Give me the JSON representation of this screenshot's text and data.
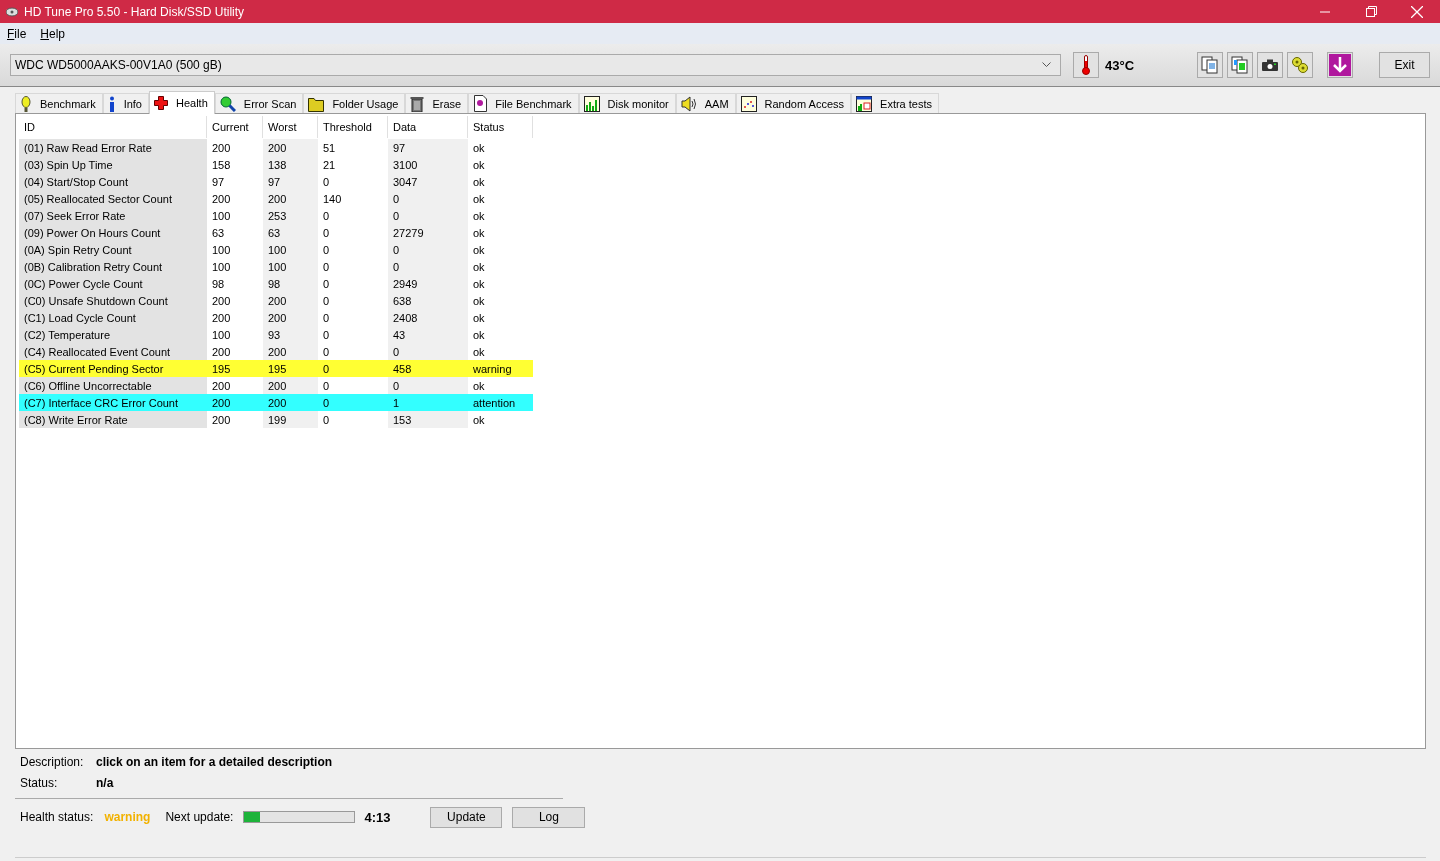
{
  "window": {
    "title": "HD Tune Pro 5.50 - Hard Disk/SSD Utility"
  },
  "menu": [
    {
      "label": "File",
      "accel_underlined": true
    },
    {
      "label": "Help",
      "accel_underlined": true
    }
  ],
  "toolbar": {
    "drive": "WDC WD5000AAKS-00V1A0 (500 gB)",
    "temperature": "43°C",
    "exit": "Exit"
  },
  "tabs": [
    {
      "label": "Benchmark",
      "selected": false
    },
    {
      "label": "Info",
      "selected": false
    },
    {
      "label": "Health",
      "selected": true
    },
    {
      "label": "Error Scan",
      "selected": false
    },
    {
      "label": "Folder Usage",
      "selected": false
    },
    {
      "label": "Erase",
      "selected": false
    },
    {
      "label": "File Benchmark",
      "selected": false
    },
    {
      "label": "Disk monitor",
      "selected": false
    },
    {
      "label": "AAM",
      "selected": false
    },
    {
      "label": "Random Access",
      "selected": false
    },
    {
      "label": "Extra tests",
      "selected": false
    }
  ],
  "table": {
    "columns": [
      "ID",
      "Current",
      "Worst",
      "Threshold",
      "Data",
      "Status"
    ],
    "rows": [
      {
        "cells": [
          "(01) Raw Read Error Rate",
          "200",
          "200",
          "51",
          "97",
          "ok"
        ]
      },
      {
        "cells": [
          "(03) Spin Up Time",
          "158",
          "138",
          "21",
          "3100",
          "ok"
        ]
      },
      {
        "cells": [
          "(04) Start/Stop Count",
          "97",
          "97",
          "0",
          "3047",
          "ok"
        ]
      },
      {
        "cells": [
          "(05) Reallocated Sector Count",
          "200",
          "200",
          "140",
          "0",
          "ok"
        ]
      },
      {
        "cells": [
          "(07) Seek Error Rate",
          "100",
          "253",
          "0",
          "0",
          "ok"
        ]
      },
      {
        "cells": [
          "(09) Power On Hours Count",
          "63",
          "63",
          "0",
          "27279",
          "ok"
        ]
      },
      {
        "cells": [
          "(0A) Spin Retry Count",
          "100",
          "100",
          "0",
          "0",
          "ok"
        ]
      },
      {
        "cells": [
          "(0B) Calibration Retry Count",
          "100",
          "100",
          "0",
          "0",
          "ok"
        ]
      },
      {
        "cells": [
          "(0C) Power Cycle Count",
          "98",
          "98",
          "0",
          "2949",
          "ok"
        ]
      },
      {
        "cells": [
          "(C0) Unsafe Shutdown Count",
          "200",
          "200",
          "0",
          "638",
          "ok"
        ]
      },
      {
        "cells": [
          "(C1) Load Cycle Count",
          "200",
          "200",
          "0",
          "2408",
          "ok"
        ]
      },
      {
        "cells": [
          "(C2) Temperature",
          "100",
          "93",
          "0",
          "43",
          "ok"
        ]
      },
      {
        "cells": [
          "(C4) Reallocated Event Count",
          "200",
          "200",
          "0",
          "0",
          "ok"
        ]
      },
      {
        "cells": [
          "(C5) Current Pending Sector",
          "195",
          "195",
          "0",
          "458",
          "warning"
        ],
        "color": "#ffff33"
      },
      {
        "cells": [
          "(C6) Offline Uncorrectable",
          "200",
          "200",
          "0",
          "0",
          "ok"
        ]
      },
      {
        "cells": [
          "(C7) Interface CRC Error Count",
          "200",
          "200",
          "0",
          "1",
          "attention"
        ],
        "color": "#33ffff"
      },
      {
        "cells": [
          "(C8) Write Error Rate",
          "200",
          "199",
          "0",
          "153",
          "ok"
        ]
      }
    ]
  },
  "details": {
    "description_label": "Description:",
    "description": "click on an item for a detailed description",
    "status_label": "Status:",
    "status": "n/a"
  },
  "footer": {
    "health_label": "Health status:",
    "health": "warning",
    "next_label": "Next update:",
    "level": 0.14,
    "countdown": "4:13",
    "update": "Update",
    "log": "Log"
  }
}
